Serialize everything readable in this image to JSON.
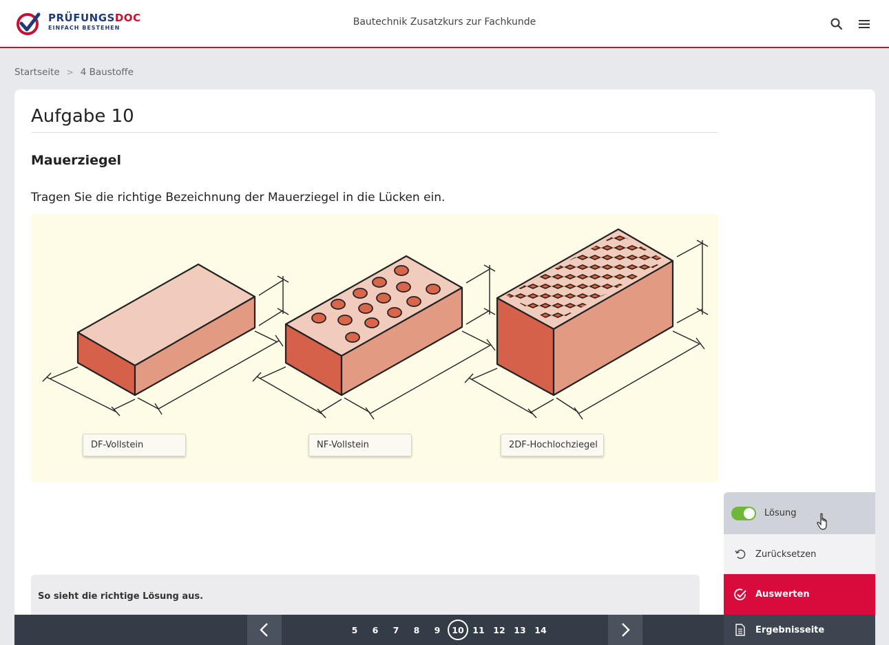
{
  "header": {
    "logo_main_a": "PRÜFUNGS",
    "logo_main_b": "DOC",
    "logo_sub": "EINFACH BESTEHEN",
    "title": "Bautechnik Zusatzkurs zur Fachkunde",
    "search_icon": "search-icon",
    "menu_icon": "menu-icon"
  },
  "breadcrumb": {
    "home": "Startseite",
    "separator": ">",
    "current": "4 Baustoffe"
  },
  "task": {
    "title": "Aufgabe 10",
    "subtitle": "Mauerziegel",
    "instruction": "Tragen Sie die richtige Bezeichnung der Mauerziegel in die Lücken ein."
  },
  "answers": [
    {
      "label": "DF-Vollstein"
    },
    {
      "label": "NF-Vollstein"
    },
    {
      "label": "2DF-Hochlochziegel"
    }
  ],
  "solution": {
    "text": "So sieht die richtige Lösung aus."
  },
  "side_panel": {
    "loesung_label": "Lösung",
    "loesung_toggle_on": true,
    "reset_label": "Zurücksetzen",
    "evaluate_label": "Auswerten",
    "results_label": "Ergebnisseite"
  },
  "pagination": {
    "pages": [
      "5",
      "6",
      "7",
      "8",
      "9",
      "10",
      "11",
      "12",
      "13",
      "14"
    ],
    "current": "10",
    "prev_icon": "chevron-left-icon",
    "next_icon": "chevron-right-icon"
  },
  "colors": {
    "brand_red": "#d80b3c",
    "brand_blue": "#1e3a7b",
    "toggle_green": "#6fb736",
    "figure_bg": "#fefbe6",
    "nav_dark": "#333c47"
  }
}
